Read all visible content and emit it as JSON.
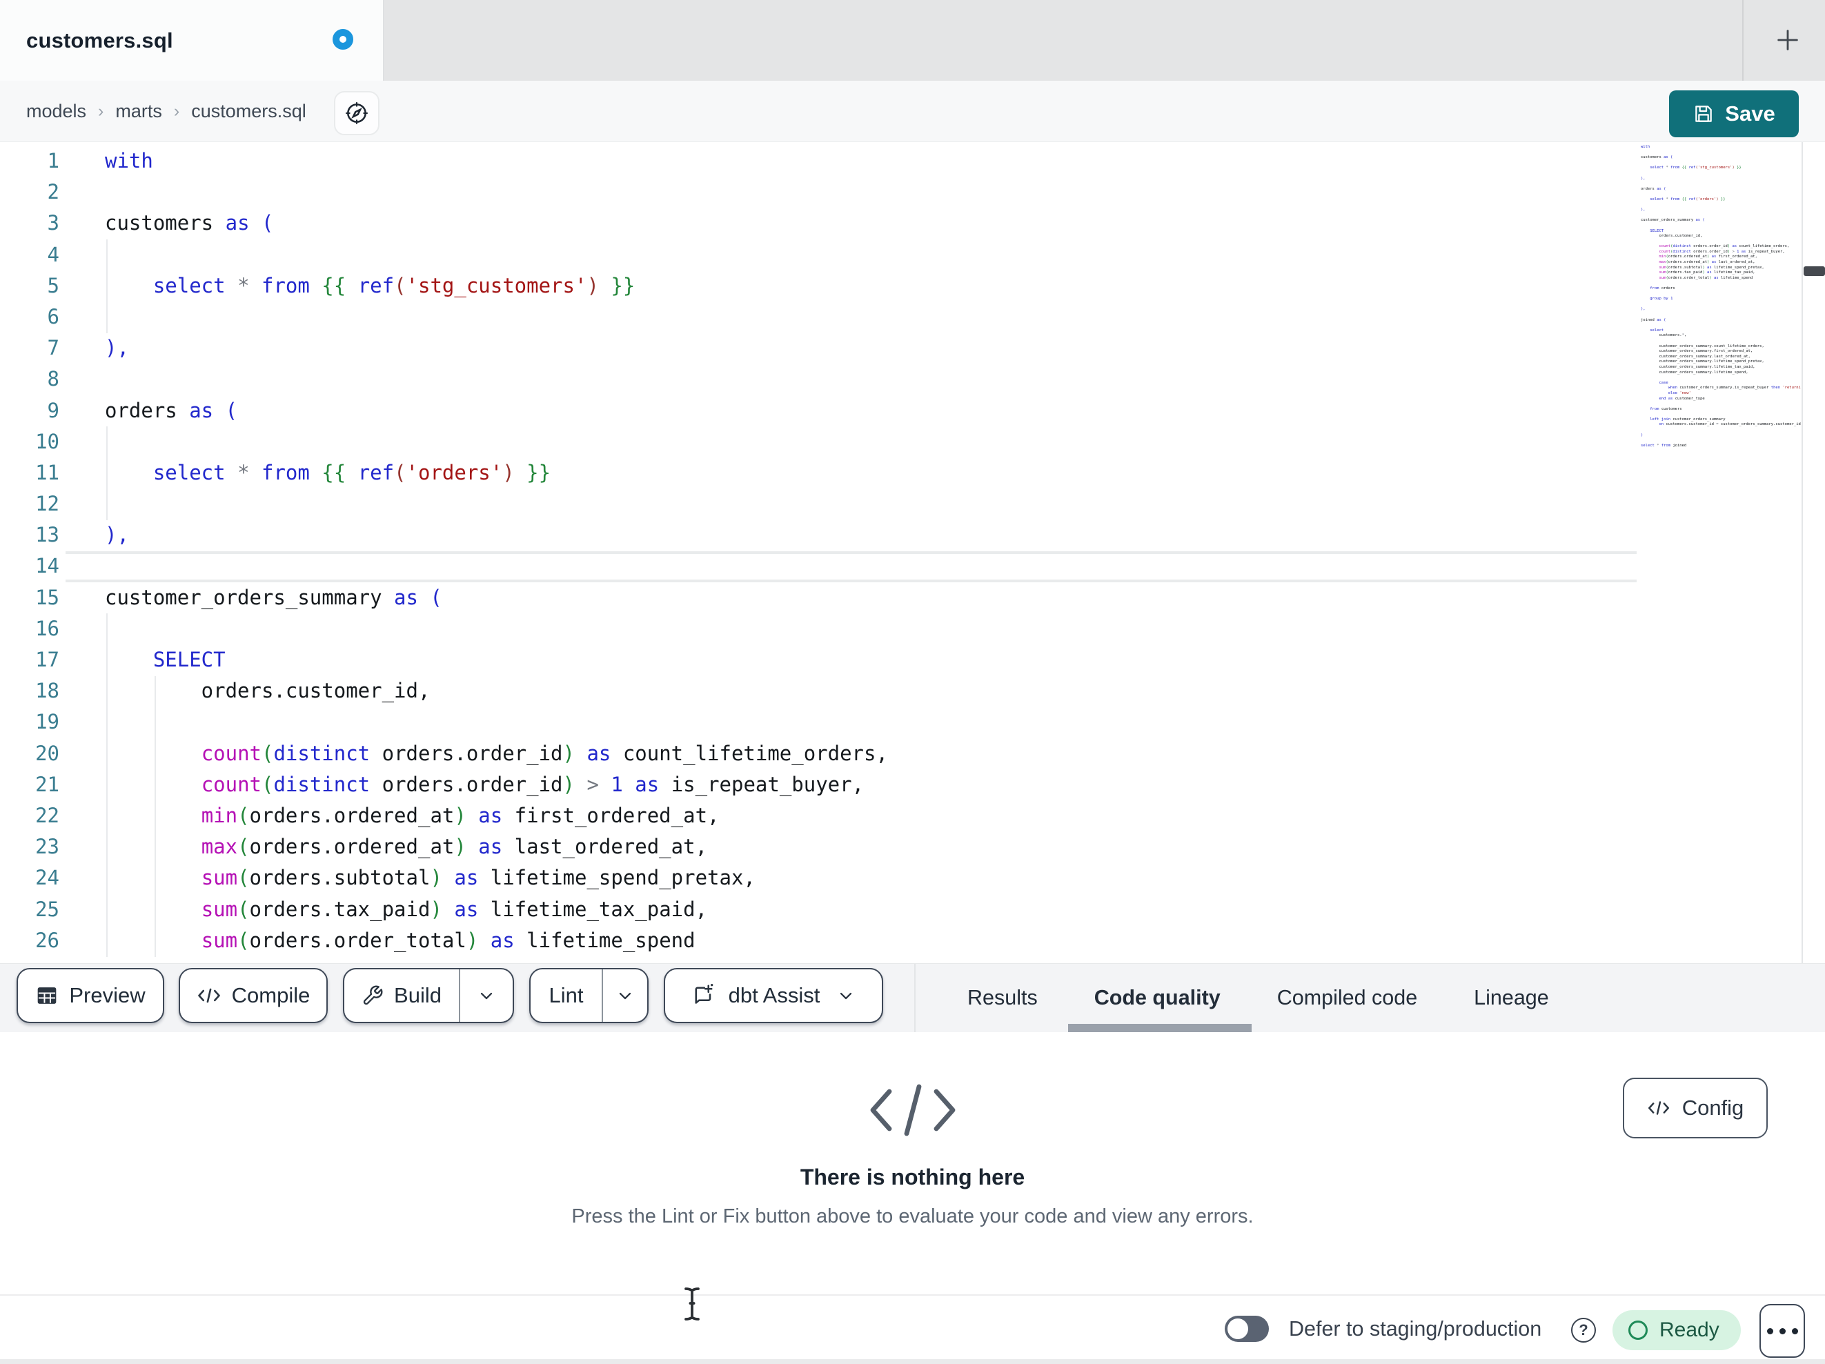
{
  "tab_bar": {
    "active_tab": "customers.sql",
    "unsaved_indicator": "unsaved-changes-dot",
    "new_tab_label": "+"
  },
  "breadcrumb": {
    "items": [
      "models",
      "marts",
      "customers.sql"
    ],
    "separator": "›"
  },
  "header": {
    "save_label": "Save"
  },
  "editor": {
    "language": "sql",
    "active_line": 14,
    "visible_line_count": 26,
    "colors": {
      "kw": "#2228cc",
      "fn": "#b511b5",
      "jin": "#23863a",
      "par": "#23863a",
      "str": "#a31515",
      "rp": "#96352f",
      "op": "#737880",
      "id": "#15191d"
    },
    "guides": [
      {
        "col": 0,
        "from": 4,
        "to": 6
      },
      {
        "col": 0,
        "from": 10,
        "to": 12
      },
      {
        "col": 0,
        "from": 16,
        "to": 26
      },
      {
        "col": 4,
        "from": 18,
        "to": 26
      }
    ],
    "lines": [
      [
        [
          "kw",
          "with"
        ]
      ],
      [],
      [
        [
          "id",
          "customers "
        ],
        [
          "kw",
          "as ("
        ]
      ],
      [],
      [
        [
          "id",
          "    "
        ],
        [
          "kw",
          "select "
        ],
        [
          "op",
          "* "
        ],
        [
          "kw",
          "from "
        ],
        [
          "jin",
          "{{ "
        ],
        [
          "kw",
          "ref"
        ],
        [
          "rp",
          "("
        ],
        [
          "str",
          "'stg_customers'"
        ],
        [
          "rp",
          ")"
        ],
        [
          "jin",
          " }}"
        ]
      ],
      [],
      [
        [
          "kw",
          "),"
        ]
      ],
      [],
      [
        [
          "id",
          "orders "
        ],
        [
          "kw",
          "as ("
        ]
      ],
      [],
      [
        [
          "id",
          "    "
        ],
        [
          "kw",
          "select "
        ],
        [
          "op",
          "* "
        ],
        [
          "kw",
          "from "
        ],
        [
          "jin",
          "{{ "
        ],
        [
          "kw",
          "ref"
        ],
        [
          "rp",
          "("
        ],
        [
          "str",
          "'orders'"
        ],
        [
          "rp",
          ")"
        ],
        [
          "jin",
          " }}"
        ]
      ],
      [],
      [
        [
          "kw",
          "),"
        ]
      ],
      [],
      [
        [
          "id",
          "customer_orders_summary "
        ],
        [
          "kw",
          "as ("
        ]
      ],
      [],
      [
        [
          "id",
          "    "
        ],
        [
          "kw",
          "SELECT"
        ]
      ],
      [
        [
          "id",
          "        orders.customer_id,"
        ]
      ],
      [],
      [
        [
          "id",
          "        "
        ],
        [
          "fn",
          "count"
        ],
        [
          "par",
          "("
        ],
        [
          "kw",
          "distinct "
        ],
        [
          "id",
          "orders.order_id"
        ],
        [
          "par",
          ")"
        ],
        [
          "kw",
          " as "
        ],
        [
          "id",
          "count_lifetime_orders,"
        ]
      ],
      [
        [
          "id",
          "        "
        ],
        [
          "fn",
          "count"
        ],
        [
          "par",
          "("
        ],
        [
          "kw",
          "distinct "
        ],
        [
          "id",
          "orders.order_id"
        ],
        [
          "par",
          ")"
        ],
        [
          "op",
          " > "
        ],
        [
          "kw",
          "1"
        ],
        [
          "kw",
          " as "
        ],
        [
          "id",
          "is_repeat_buyer,"
        ]
      ],
      [
        [
          "id",
          "        "
        ],
        [
          "fn",
          "min"
        ],
        [
          "par",
          "("
        ],
        [
          "id",
          "orders.ordered_at"
        ],
        [
          "par",
          ")"
        ],
        [
          "kw",
          " as "
        ],
        [
          "id",
          "first_ordered_at,"
        ]
      ],
      [
        [
          "id",
          "        "
        ],
        [
          "fn",
          "max"
        ],
        [
          "par",
          "("
        ],
        [
          "id",
          "orders.ordered_at"
        ],
        [
          "par",
          ")"
        ],
        [
          "kw",
          " as "
        ],
        [
          "id",
          "last_ordered_at,"
        ]
      ],
      [
        [
          "id",
          "        "
        ],
        [
          "fn",
          "sum"
        ],
        [
          "par",
          "("
        ],
        [
          "id",
          "orders.subtotal"
        ],
        [
          "par",
          ")"
        ],
        [
          "kw",
          " as "
        ],
        [
          "id",
          "lifetime_spend_pretax,"
        ]
      ],
      [
        [
          "id",
          "        "
        ],
        [
          "fn",
          "sum"
        ],
        [
          "par",
          "("
        ],
        [
          "id",
          "orders.tax_paid"
        ],
        [
          "par",
          ")"
        ],
        [
          "kw",
          " as "
        ],
        [
          "id",
          "lifetime_tax_paid,"
        ]
      ],
      [
        [
          "id",
          "        "
        ],
        [
          "fn",
          "sum"
        ],
        [
          "par",
          "("
        ],
        [
          "id",
          "orders.order_total"
        ],
        [
          "par",
          ")"
        ],
        [
          "kw",
          " as "
        ],
        [
          "id",
          "lifetime_spend"
        ]
      ],
      [],
      [
        [
          "id",
          "    "
        ],
        [
          "kw",
          "from "
        ],
        [
          "id",
          "orders"
        ]
      ],
      [],
      [
        [
          "id",
          "    "
        ],
        [
          "kw",
          "group by "
        ],
        [
          "kw",
          "1"
        ]
      ],
      [],
      [
        [
          "kw",
          "),"
        ]
      ],
      [],
      [
        [
          "id",
          "joined "
        ],
        [
          "kw",
          "as ("
        ]
      ],
      [],
      [
        [
          "id",
          "    "
        ],
        [
          "kw",
          "select"
        ]
      ],
      [
        [
          "id",
          "        customers."
        ],
        [
          "op",
          "*"
        ],
        [
          "id",
          ","
        ]
      ],
      [],
      [
        [
          "id",
          "        customer_orders_summary.count_lifetime_orders,"
        ]
      ],
      [
        [
          "id",
          "        customer_orders_summary.first_ordered_at,"
        ]
      ],
      [
        [
          "id",
          "        customer_orders_summary.last_ordered_at,"
        ]
      ],
      [
        [
          "id",
          "        customer_orders_summary.lifetime_spend_pretax,"
        ]
      ],
      [
        [
          "id",
          "        customer_orders_summary.lifetime_tax_paid,"
        ]
      ],
      [
        [
          "id",
          "        customer_orders_summary.lifetime_spend,"
        ]
      ],
      [],
      [
        [
          "id",
          "        "
        ],
        [
          "kw",
          "case"
        ]
      ],
      [
        [
          "id",
          "            "
        ],
        [
          "kw",
          "when "
        ],
        [
          "id",
          "customer_orders_summary.is_repeat_buyer "
        ],
        [
          "kw",
          "then "
        ],
        [
          "str",
          "'returning'"
        ]
      ],
      [
        [
          "id",
          "            "
        ],
        [
          "kw",
          "else "
        ],
        [
          "str",
          "'new'"
        ]
      ],
      [
        [
          "id",
          "        "
        ],
        [
          "kw",
          "end as "
        ],
        [
          "id",
          "customer_type"
        ]
      ],
      [],
      [
        [
          "id",
          "    "
        ],
        [
          "kw",
          "from "
        ],
        [
          "id",
          "customers"
        ]
      ],
      [],
      [
        [
          "id",
          "    "
        ],
        [
          "kw",
          "left join "
        ],
        [
          "id",
          "customer_orders_summary"
        ]
      ],
      [
        [
          "id",
          "        "
        ],
        [
          "kw",
          "on "
        ],
        [
          "id",
          "customers.customer_id "
        ],
        [
          "op",
          "= "
        ],
        [
          "id",
          "customer_orders_summary.customer_id"
        ]
      ],
      [],
      [
        [
          "kw",
          ")"
        ]
      ],
      [],
      [
        [
          "kw",
          "select "
        ],
        [
          "op",
          "* "
        ],
        [
          "kw",
          "from "
        ],
        [
          "id",
          "joined"
        ]
      ]
    ]
  },
  "toolbar": {
    "buttons": [
      {
        "label": "Preview",
        "icon": "table-icon"
      },
      {
        "label": "Compile",
        "icon": "code-icon"
      },
      {
        "label": "Build",
        "icon": "wrench-icon",
        "split": true
      },
      {
        "label": "Lint",
        "split": true
      },
      {
        "label": "dbt Assist",
        "icon": "assist-icon",
        "chevron": true
      }
    ]
  },
  "panel_tabs": {
    "items": [
      "Results",
      "Code quality",
      "Compiled code",
      "Lineage"
    ],
    "active": "Code quality"
  },
  "results_panel": {
    "empty_icon": "code-icon",
    "title": "There is nothing here",
    "description": "Press the Lint or Fix button above to evaluate your code and view any errors.",
    "config_label": "Config"
  },
  "status_bar": {
    "defer_toggle_state": "off",
    "defer_label": "Defer to staging/production",
    "ready_label": "Ready"
  },
  "theme": {
    "save_teal": "#10707a",
    "tab_dot_blue": "#1b96dd",
    "ready_bg": "#d7f3e2",
    "ready_ring": "#1f8a58",
    "ready_text": "#1c5843",
    "tab_underline": "#9aa1ab",
    "line_number": "#3a7d90"
  }
}
